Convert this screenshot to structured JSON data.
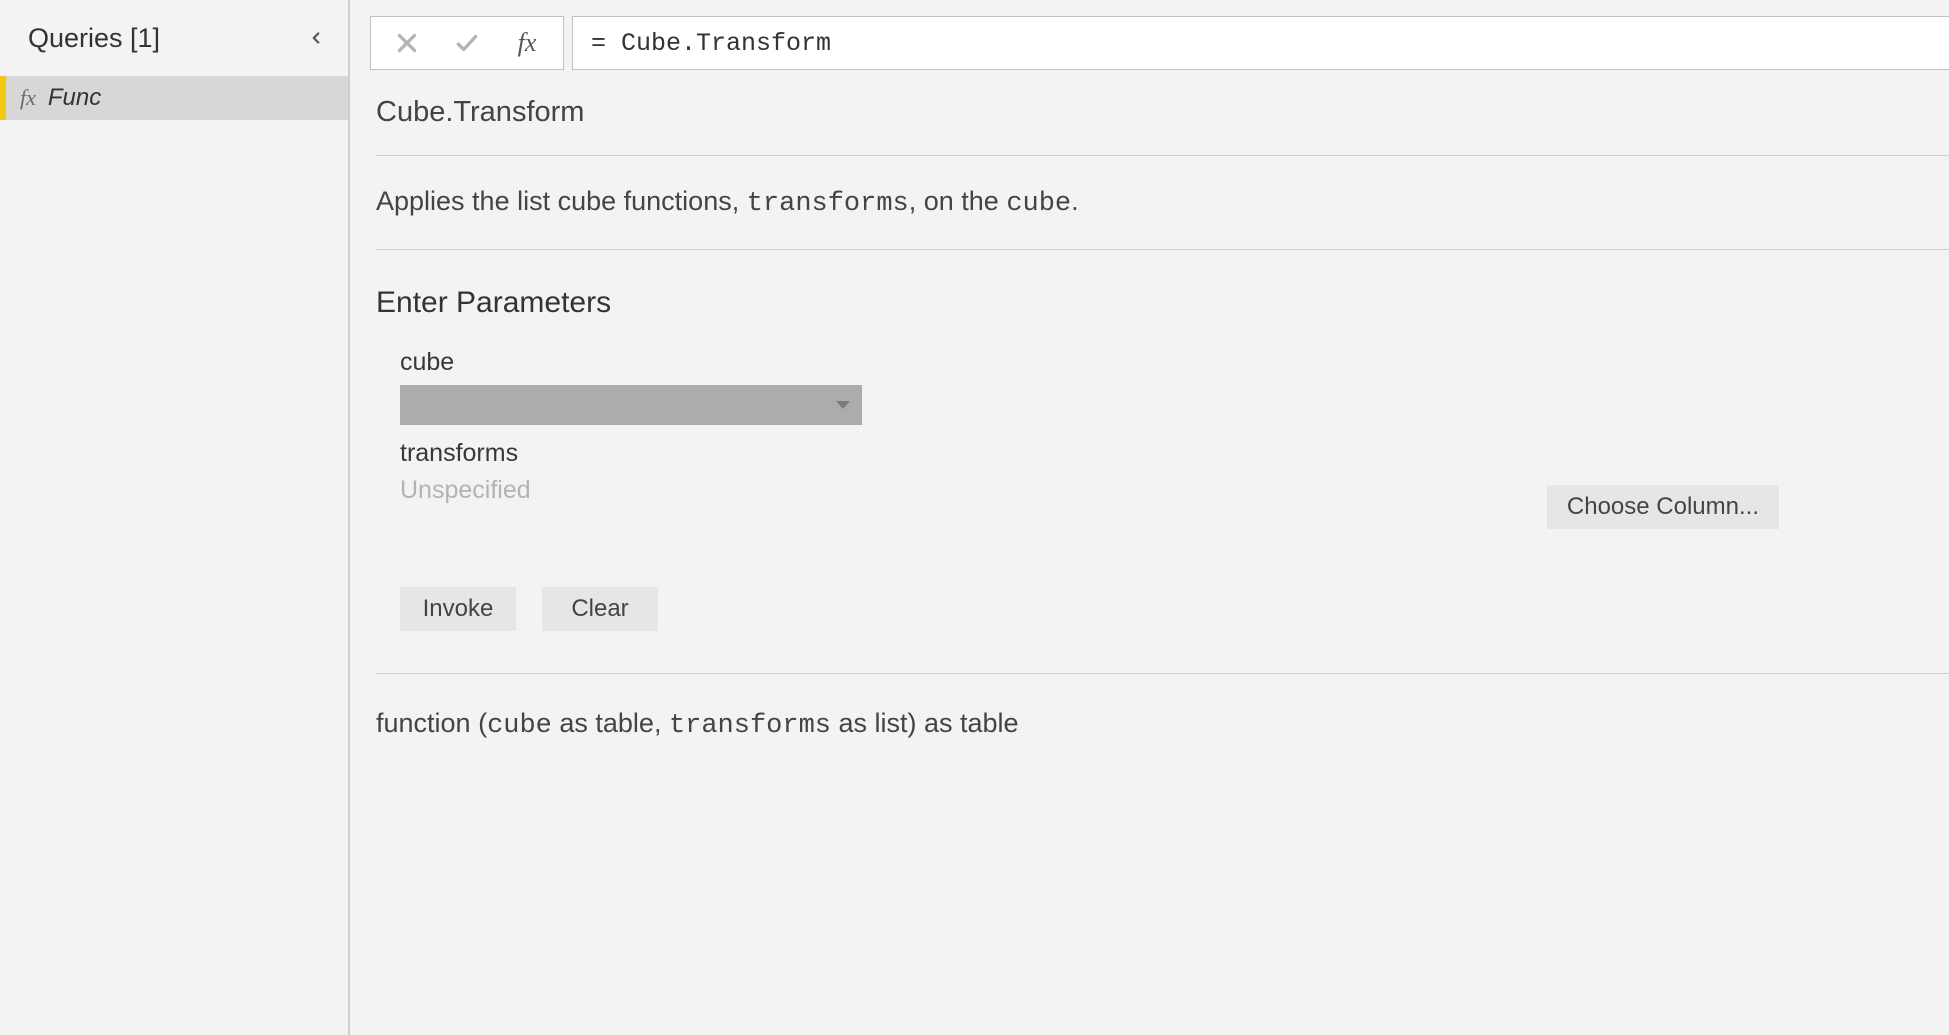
{
  "sidebar": {
    "title": "Queries [1]",
    "collapse_icon": "chevron-left",
    "items": [
      {
        "fx_label": "fx",
        "name": "Func"
      }
    ]
  },
  "formula_bar": {
    "cancel_icon": "x",
    "accept_icon": "check",
    "fx_label": "fx",
    "formula": "= Cube.Transform"
  },
  "function": {
    "name": "Cube.Transform",
    "description_prefix": "Applies the list cube functions, ",
    "description_code1": "transforms",
    "description_mid": ", on the ",
    "description_code2": "cube",
    "description_suffix": "."
  },
  "parameters": {
    "heading": "Enter Parameters",
    "param1": {
      "label": "cube",
      "value": ""
    },
    "param2": {
      "label": "transforms",
      "placeholder": "Unspecified"
    },
    "choose_column_label": "Choose Column...",
    "invoke_label": "Invoke",
    "clear_label": "Clear"
  },
  "signature": {
    "prefix": "function (",
    "p1": "cube",
    "t1": " as table, ",
    "p2": "transforms",
    "t2": " as list) as table"
  }
}
